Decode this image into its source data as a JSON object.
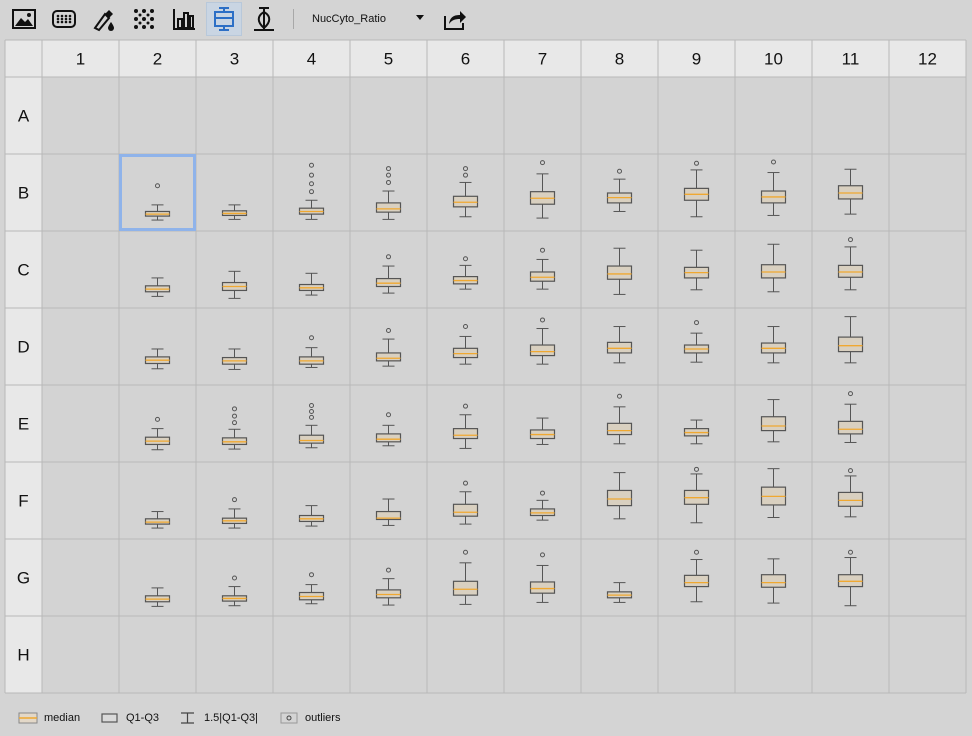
{
  "toolbar": {
    "buttons": [
      {
        "id": "image",
        "icon": "image-icon"
      },
      {
        "id": "heatmap",
        "icon": "well-plate-icon"
      },
      {
        "id": "dropper",
        "icon": "color-dropper-icon"
      },
      {
        "id": "scatter",
        "icon": "dot-grid-icon"
      },
      {
        "id": "bar",
        "icon": "bar-chart-icon"
      },
      {
        "id": "boxplot",
        "icon": "boxplot-icon",
        "active": true
      },
      {
        "id": "violin",
        "icon": "violin-icon"
      }
    ],
    "metric": "NucCyto_Ratio",
    "export_icon": "export-icon"
  },
  "chart_data": {
    "type": "boxplot",
    "columns": [
      "1",
      "2",
      "3",
      "4",
      "5",
      "6",
      "7",
      "8",
      "9",
      "10",
      "11",
      "12"
    ],
    "rows": [
      "A",
      "B",
      "C",
      "D",
      "E",
      "F",
      "G",
      "H"
    ],
    "selected_well": "B2",
    "y_range": [
      0,
      1
    ],
    "wells": {
      "B2": {
        "whislo": 0.09,
        "q1": 0.15,
        "med": 0.18,
        "q3": 0.22,
        "whishi": 0.32,
        "fliers": [
          0.61
        ]
      },
      "B3": {
        "whislo": 0.1,
        "q1": 0.16,
        "med": 0.19,
        "q3": 0.23,
        "whishi": 0.32,
        "fliers": []
      },
      "B4": {
        "whislo": 0.1,
        "q1": 0.18,
        "med": 0.22,
        "q3": 0.27,
        "whishi": 0.39,
        "fliers": [
          0.52,
          0.64,
          0.77,
          0.92
        ]
      },
      "B5": {
        "whislo": 0.1,
        "q1": 0.21,
        "med": 0.26,
        "q3": 0.35,
        "whishi": 0.53,
        "fliers": [
          0.66,
          0.77,
          0.87
        ]
      },
      "B6": {
        "whislo": 0.14,
        "q1": 0.29,
        "med": 0.36,
        "q3": 0.45,
        "whishi": 0.66,
        "fliers": [
          0.77,
          0.87
        ]
      },
      "B7": {
        "whislo": 0.12,
        "q1": 0.33,
        "med": 0.42,
        "q3": 0.52,
        "whishi": 0.79,
        "fliers": [
          0.96
        ]
      },
      "B8": {
        "whislo": 0.22,
        "q1": 0.35,
        "med": 0.43,
        "q3": 0.5,
        "whishi": 0.71,
        "fliers": [
          0.83
        ]
      },
      "B9": {
        "whislo": 0.14,
        "q1": 0.39,
        "med": 0.48,
        "q3": 0.57,
        "whishi": 0.85,
        "fliers": [
          0.95
        ]
      },
      "B10": {
        "whislo": 0.16,
        "q1": 0.35,
        "med": 0.44,
        "q3": 0.53,
        "whishi": 0.81,
        "fliers": [
          0.97
        ]
      },
      "B11": {
        "whislo": 0.18,
        "q1": 0.41,
        "med": 0.5,
        "q3": 0.61,
        "whishi": 0.86,
        "fliers": []
      },
      "C2": {
        "whislo": 0.1,
        "q1": 0.17,
        "med": 0.21,
        "q3": 0.26,
        "whishi": 0.38,
        "fliers": []
      },
      "C3": {
        "whislo": 0.07,
        "q1": 0.19,
        "med": 0.25,
        "q3": 0.31,
        "whishi": 0.48,
        "fliers": []
      },
      "C4": {
        "whislo": 0.12,
        "q1": 0.19,
        "med": 0.23,
        "q3": 0.28,
        "whishi": 0.45,
        "fliers": []
      },
      "C5": {
        "whislo": 0.15,
        "q1": 0.25,
        "med": 0.3,
        "q3": 0.37,
        "whishi": 0.56,
        "fliers": [
          0.7
        ]
      },
      "C6": {
        "whislo": 0.21,
        "q1": 0.29,
        "med": 0.34,
        "q3": 0.4,
        "whishi": 0.57,
        "fliers": [
          0.67
        ]
      },
      "C7": {
        "whislo": 0.21,
        "q1": 0.33,
        "med": 0.39,
        "q3": 0.47,
        "whishi": 0.66,
        "fliers": [
          0.8
        ]
      },
      "C8": {
        "whislo": 0.13,
        "q1": 0.36,
        "med": 0.44,
        "q3": 0.56,
        "whishi": 0.83,
        "fliers": []
      },
      "C9": {
        "whislo": 0.2,
        "q1": 0.38,
        "med": 0.46,
        "q3": 0.54,
        "whishi": 0.8,
        "fliers": []
      },
      "C10": {
        "whislo": 0.17,
        "q1": 0.38,
        "med": 0.47,
        "q3": 0.58,
        "whishi": 0.89,
        "fliers": []
      },
      "C11": {
        "whislo": 0.2,
        "q1": 0.39,
        "med": 0.47,
        "q3": 0.57,
        "whishi": 0.85,
        "fliers": [
          0.96
        ]
      },
      "D2": {
        "whislo": 0.17,
        "q1": 0.25,
        "med": 0.3,
        "q3": 0.35,
        "whishi": 0.47,
        "fliers": []
      },
      "D3": {
        "whislo": 0.16,
        "q1": 0.24,
        "med": 0.29,
        "q3": 0.34,
        "whishi": 0.47,
        "fliers": []
      },
      "D4": {
        "whislo": 0.19,
        "q1": 0.24,
        "med": 0.29,
        "q3": 0.35,
        "whishi": 0.49,
        "fliers": [
          0.64
        ]
      },
      "D5": {
        "whislo": 0.21,
        "q1": 0.29,
        "med": 0.33,
        "q3": 0.41,
        "whishi": 0.62,
        "fliers": [
          0.75
        ]
      },
      "D6": {
        "whislo": 0.24,
        "q1": 0.34,
        "med": 0.4,
        "q3": 0.48,
        "whishi": 0.66,
        "fliers": [
          0.81
        ]
      },
      "D7": {
        "whislo": 0.24,
        "q1": 0.37,
        "med": 0.43,
        "q3": 0.53,
        "whishi": 0.78,
        "fliers": [
          0.91
        ]
      },
      "D8": {
        "whislo": 0.26,
        "q1": 0.41,
        "med": 0.48,
        "q3": 0.57,
        "whishi": 0.81,
        "fliers": []
      },
      "D9": {
        "whislo": 0.27,
        "q1": 0.41,
        "med": 0.47,
        "q3": 0.53,
        "whishi": 0.71,
        "fliers": [
          0.87
        ]
      },
      "D10": {
        "whislo": 0.26,
        "q1": 0.41,
        "med": 0.48,
        "q3": 0.56,
        "whishi": 0.81,
        "fliers": []
      },
      "D11": {
        "whislo": 0.26,
        "q1": 0.43,
        "med": 0.52,
        "q3": 0.65,
        "whishi": 0.96,
        "fliers": []
      },
      "E2": {
        "whislo": 0.11,
        "q1": 0.19,
        "med": 0.24,
        "q3": 0.3,
        "whishi": 0.43,
        "fliers": [
          0.57
        ]
      },
      "E3": {
        "whislo": 0.12,
        "q1": 0.19,
        "med": 0.23,
        "q3": 0.29,
        "whishi": 0.42,
        "fliers": [
          0.52,
          0.62,
          0.73
        ]
      },
      "E4": {
        "whislo": 0.14,
        "q1": 0.21,
        "med": 0.25,
        "q3": 0.33,
        "whishi": 0.48,
        "fliers": [
          0.6,
          0.69,
          0.78
        ]
      },
      "E5": {
        "whislo": 0.17,
        "q1": 0.23,
        "med": 0.27,
        "q3": 0.35,
        "whishi": 0.48,
        "fliers": [
          0.64
        ]
      },
      "E6": {
        "whislo": 0.13,
        "q1": 0.28,
        "med": 0.33,
        "q3": 0.43,
        "whishi": 0.64,
        "fliers": [
          0.77
        ]
      },
      "E7": {
        "whislo": 0.19,
        "q1": 0.28,
        "med": 0.34,
        "q3": 0.41,
        "whishi": 0.59,
        "fliers": []
      },
      "E8": {
        "whislo": 0.2,
        "q1": 0.34,
        "med": 0.4,
        "q3": 0.51,
        "whishi": 0.76,
        "fliers": [
          0.92
        ]
      },
      "E9": {
        "whislo": 0.2,
        "q1": 0.32,
        "med": 0.37,
        "q3": 0.43,
        "whishi": 0.56,
        "fliers": []
      },
      "E10": {
        "whislo": 0.23,
        "q1": 0.4,
        "med": 0.47,
        "q3": 0.61,
        "whishi": 0.87,
        "fliers": []
      },
      "E11": {
        "whislo": 0.22,
        "q1": 0.35,
        "med": 0.42,
        "q3": 0.54,
        "whishi": 0.8,
        "fliers": [
          0.96
        ]
      },
      "F2": {
        "whislo": 0.09,
        "q1": 0.15,
        "med": 0.18,
        "q3": 0.23,
        "whishi": 0.34,
        "fliers": []
      },
      "F3": {
        "whislo": 0.09,
        "q1": 0.16,
        "med": 0.2,
        "q3": 0.24,
        "whishi": 0.38,
        "fliers": [
          0.52
        ]
      },
      "F4": {
        "whislo": 0.12,
        "q1": 0.19,
        "med": 0.23,
        "q3": 0.28,
        "whishi": 0.43,
        "fliers": []
      },
      "F5": {
        "whislo": 0.13,
        "q1": 0.22,
        "med": 0.24,
        "q3": 0.34,
        "whishi": 0.53,
        "fliers": []
      },
      "F6": {
        "whislo": 0.15,
        "q1": 0.27,
        "med": 0.33,
        "q3": 0.45,
        "whishi": 0.64,
        "fliers": [
          0.77
        ]
      },
      "F7": {
        "whislo": 0.21,
        "q1": 0.28,
        "med": 0.32,
        "q3": 0.38,
        "whishi": 0.51,
        "fliers": [
          0.62
        ]
      },
      "F8": {
        "whislo": 0.23,
        "q1": 0.43,
        "med": 0.53,
        "q3": 0.66,
        "whishi": 0.93,
        "fliers": []
      },
      "F9": {
        "whislo": 0.17,
        "q1": 0.45,
        "med": 0.55,
        "q3": 0.66,
        "whishi": 0.91,
        "fliers": [
          0.98
        ]
      },
      "F10": {
        "whislo": 0.25,
        "q1": 0.44,
        "med": 0.57,
        "q3": 0.71,
        "whishi": 0.99,
        "fliers": []
      },
      "F11": {
        "whislo": 0.26,
        "q1": 0.42,
        "med": 0.51,
        "q3": 0.63,
        "whishi": 0.88,
        "fliers": [
          0.96
        ]
      },
      "G2": {
        "whislo": 0.07,
        "q1": 0.14,
        "med": 0.18,
        "q3": 0.23,
        "whishi": 0.35,
        "fliers": []
      },
      "G3": {
        "whislo": 0.08,
        "q1": 0.15,
        "med": 0.19,
        "q3": 0.23,
        "whishi": 0.37,
        "fliers": [
          0.5
        ]
      },
      "G4": {
        "whislo": 0.11,
        "q1": 0.17,
        "med": 0.22,
        "q3": 0.28,
        "whishi": 0.4,
        "fliers": [
          0.55
        ]
      },
      "G5": {
        "whislo": 0.09,
        "q1": 0.2,
        "med": 0.25,
        "q3": 0.32,
        "whishi": 0.49,
        "fliers": [
          0.62
        ]
      },
      "G6": {
        "whislo": 0.1,
        "q1": 0.24,
        "med": 0.33,
        "q3": 0.45,
        "whishi": 0.73,
        "fliers": [
          0.89
        ]
      },
      "G7": {
        "whislo": 0.13,
        "q1": 0.27,
        "med": 0.34,
        "q3": 0.44,
        "whishi": 0.69,
        "fliers": [
          0.85
        ]
      },
      "G8": {
        "whislo": 0.13,
        "q1": 0.2,
        "med": 0.24,
        "q3": 0.29,
        "whishi": 0.43,
        "fliers": []
      },
      "G9": {
        "whislo": 0.14,
        "q1": 0.37,
        "med": 0.43,
        "q3": 0.54,
        "whishi": 0.78,
        "fliers": [
          0.89
        ]
      },
      "G10": {
        "whislo": 0.12,
        "q1": 0.36,
        "med": 0.43,
        "q3": 0.55,
        "whishi": 0.79,
        "fliers": []
      },
      "G11": {
        "whislo": 0.08,
        "q1": 0.37,
        "med": 0.45,
        "q3": 0.55,
        "whishi": 0.81,
        "fliers": [
          0.89
        ]
      }
    }
  },
  "legend": {
    "median": "median",
    "box": "Q1-Q3",
    "whisker": "1.5|Q1-Q3|",
    "outliers": "outliers"
  },
  "colors": {
    "median": "#f0a830",
    "box_fill": "#d9d0c0",
    "stroke": "#555555",
    "grid": "#b8b8b8",
    "header_bg": "#e8e8e8",
    "selection": "#8fb3ea"
  }
}
